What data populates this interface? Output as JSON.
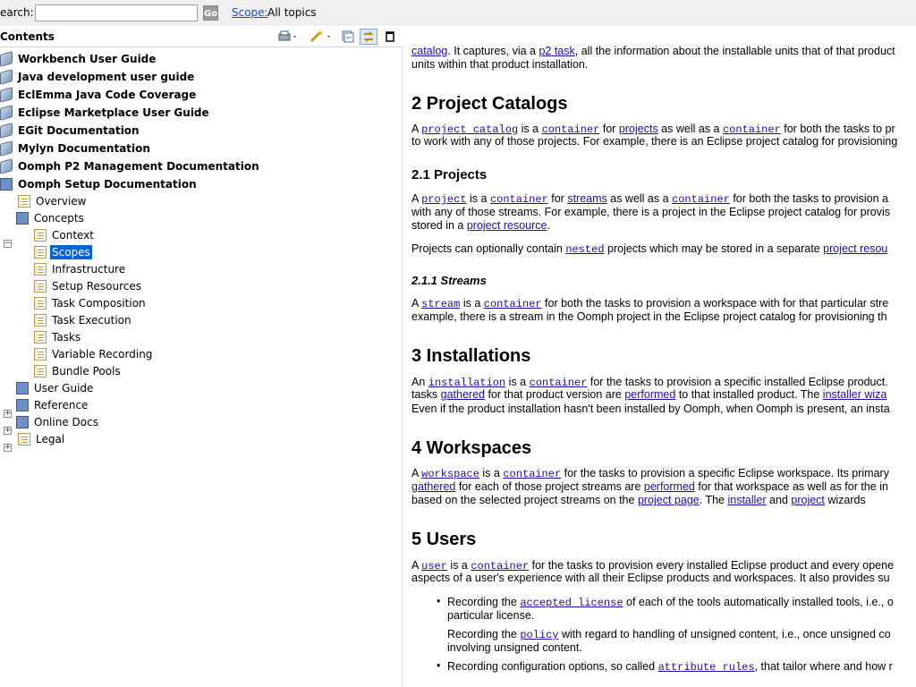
{
  "search": {
    "label": "earch:",
    "value": "",
    "go": "Go",
    "scope_link": "Scope:",
    "scope_value": "All topics"
  },
  "contents": {
    "title": "Contents"
  },
  "tree": {
    "books": [
      "Workbench User Guide",
      "Java development user guide",
      "EclEmma Java Code Coverage",
      "Eclipse Marketplace User Guide",
      "EGit Documentation",
      "Mylyn Documentation",
      "Oomph P2 Management Documentation",
      "Oomph Setup Documentation"
    ],
    "overview": "Overview",
    "concepts": "Concepts",
    "concept_items": [
      "Context",
      "Scopes",
      "Infrastructure",
      "Setup Resources",
      "Task Composition",
      "Task Execution",
      "Tasks",
      "Variable Recording",
      "Bundle Pools"
    ],
    "user_guide": "User Guide",
    "reference": "Reference",
    "online_docs": "Online Docs",
    "legal": "Legal"
  },
  "doc": {
    "intro1_link": "catalog",
    "intro1_a": ". It captures, via a ",
    "intro1_link2": "p2 task",
    "intro1_b": ", all the information about the installable units that of that product",
    "intro2": "units within that product installation.",
    "h2_catalogs": "2  Project Catalogs",
    "cat_p1": [
      "A ",
      "project catalog",
      " is a ",
      "container",
      " for ",
      "projects",
      " as well as a ",
      "container",
      " for both the tasks to pr"
    ],
    "cat_p2": "to work with any of those projects. For example, there is an Eclipse project catalog for provisioning",
    "h3_projects": "2.1  Projects",
    "proj_p1": [
      "A ",
      "project",
      " is a ",
      "container",
      " for ",
      "streams",
      " as well as a ",
      "container",
      " for both the tasks to provision a"
    ],
    "proj_p2": "with any of those streams. For example, there is a project in the Eclipse project catalog for provis",
    "proj_p3a": "stored in a ",
    "proj_p3_link": "project resource",
    "proj_p3b": ".",
    "proj_p4a": "Projects can optionally contain ",
    "proj_p4_link": "nested",
    "proj_p4b": " projects which may be stored in a separate ",
    "proj_p4_link2": "project resou",
    "h4_streams": "2.1.1  Streams",
    "str_p1": [
      "A ",
      "stream",
      " is a ",
      "container",
      " for both the tasks to provision a workspace with for that particular stre"
    ],
    "str_p2": "example, there is a stream in the Oomph project in the Eclipse project catalog for provisioning th",
    "h2_install": "3  Installations",
    "inst_p1": [
      "An ",
      "installation",
      " is a ",
      "container",
      " for the tasks to provision a specific installed Eclipse product. "
    ],
    "inst_p2": [
      "tasks ",
      "gathered",
      " for that product version are ",
      "performed",
      " to that installed product. The ",
      "installer wiza"
    ],
    "inst_p3": "Even if the product installation hasn't been installed by Oomph, when Oomph is present, an insta",
    "h2_workspaces": "4  Workspaces",
    "ws_p1": [
      "A ",
      "workspace",
      " is a ",
      "container",
      " for the tasks to provision a specific Eclipse workspace. Its primary"
    ],
    "ws_p2": [
      "gathered",
      " for each of those project streams are ",
      "performed",
      " for that workspace as well as for the in"
    ],
    "ws_p3": [
      "based on the selected project streams on the ",
      "project page",
      ". The ",
      "installer",
      " and ",
      "project",
      " wizards"
    ],
    "h2_users": "5  Users",
    "usr_p1": [
      "A ",
      "user",
      " is a ",
      "container",
      " for the tasks to provision every installed Eclipse product and every opene"
    ],
    "usr_p2": "aspects of a user's experience with all their Eclipse products and workspaces. It also provides su",
    "b1a": [
      "Recording the ",
      "accepted license",
      " of each of the tools automatically installed tools, i.e., o"
    ],
    "b1b": "particular license.",
    "b1c": [
      "Recording the ",
      "policy",
      " with regard to handling of unsigned content, i.e., once unsigned co"
    ],
    "b1d": "involving unsigned content.",
    "b2": [
      "Recording configuration options, so called ",
      "attribute rules",
      ", that tailor where and how r"
    ]
  }
}
